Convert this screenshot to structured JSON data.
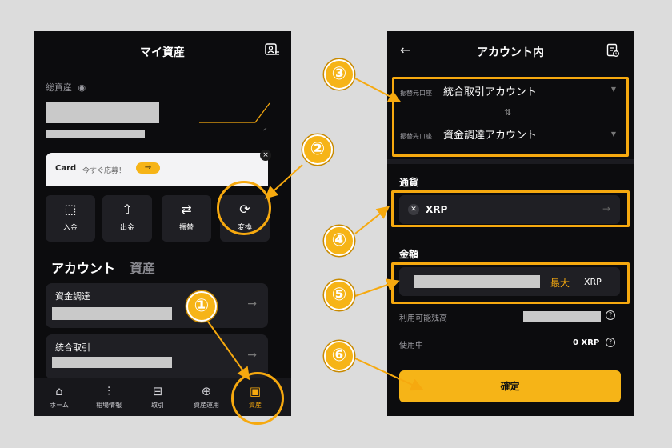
{
  "left": {
    "title": "マイ資産",
    "total_label": "総資産",
    "promo": {
      "label": "Card",
      "text": "今すぐ応募！",
      "arrow": "→",
      "close": "×"
    },
    "actions": [
      {
        "label": "入金",
        "icon": "deposit-icon",
        "glyph": "⬚"
      },
      {
        "label": "出金",
        "icon": "withdraw-icon",
        "glyph": "⇧"
      },
      {
        "label": "振替",
        "icon": "transfer-icon",
        "glyph": "⇄"
      },
      {
        "label": "変換",
        "icon": "convert-icon",
        "glyph": "⟳"
      }
    ],
    "tabs": [
      {
        "label": "アカウント"
      },
      {
        "label": "資産"
      }
    ],
    "accounts": [
      {
        "name": "資金調達"
      },
      {
        "name": "統合取引"
      }
    ],
    "nav": [
      {
        "label": "ホーム",
        "icon": "home-icon",
        "glyph": "⌂"
      },
      {
        "label": "相場情報",
        "icon": "candlestick-icon",
        "glyph": "⫶"
      },
      {
        "label": "取引",
        "icon": "trade-icon",
        "glyph": "⊟"
      },
      {
        "label": "資産運用",
        "icon": "earn-icon",
        "glyph": "⊕"
      },
      {
        "label": "資産",
        "icon": "wallet-icon",
        "glyph": "▣"
      }
    ]
  },
  "right": {
    "title": "アカウント内",
    "from_label": "振替元口座",
    "from_value": "統合取引アカウント",
    "to_label": "振替先口座",
    "to_value": "資金調達アカウント",
    "currency_label": "通貨",
    "currency_value": "XRP",
    "amount_label": "金額",
    "max_label": "最大",
    "amount_unit": "XRP",
    "available_label": "利用可能残高",
    "in_use_label": "使用中",
    "in_use_value": "0 XRP",
    "confirm_label": "確定"
  },
  "annotations": [
    "①",
    "②",
    "③",
    "④",
    "⑤",
    "⑥"
  ],
  "colors": {
    "accent": "#f6a90f",
    "badge": "#f6b417",
    "background": "#0c0c0e",
    "card": "#1f1f24"
  }
}
